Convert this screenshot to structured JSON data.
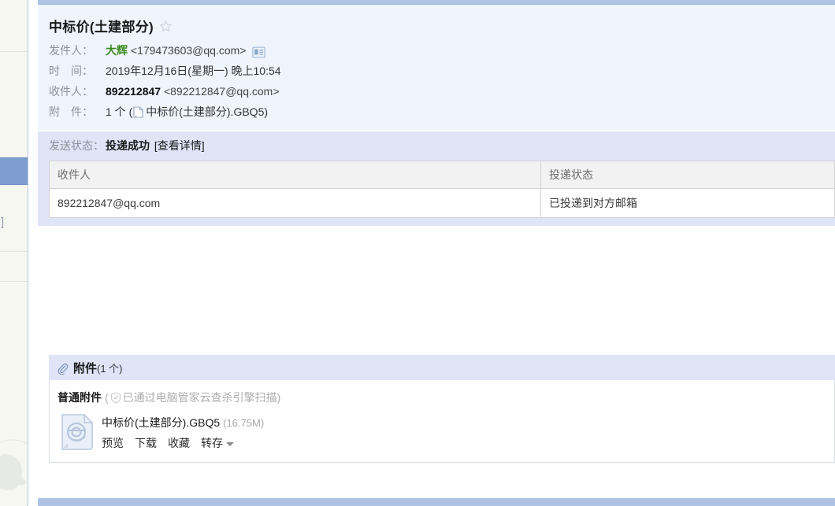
{
  "left_pane": {
    "truncated_text_fragment": "空]",
    "selected_row": true,
    "watermark": "qq-penguin-watermark"
  },
  "mail": {
    "subject": "中标价(土建部分)",
    "star_icon": "star-outline-icon",
    "from": {
      "label": "发件人：",
      "display_name": "大辉",
      "address": "<179473603@qq.com>",
      "contact_card_icon": "contact-card-icon"
    },
    "time": {
      "label": "时　间：",
      "value": "2019年12月16日(星期一) 晚上10:54"
    },
    "to": {
      "label": "收件人：",
      "display_name": "892212847",
      "address": "<892212847@qq.com>"
    },
    "attachment_summary": {
      "label": "附　件：",
      "count_text": "1 个 (",
      "file_icon": "file-icon",
      "file_name": "中标价(土建部分).GBQ5",
      "suffix": ")"
    }
  },
  "send_status": {
    "label": "发送状态：",
    "value": "投递成功",
    "detail_link": "[查看详情]",
    "table": {
      "columns": [
        "收件人",
        "投递状态"
      ],
      "rows": [
        [
          "892212847@qq.com",
          "已投递到对方邮箱"
        ]
      ]
    }
  },
  "attachments": {
    "header_icon": "paperclip-icon",
    "header_title": "附件",
    "header_count": "(1 个)",
    "kind_label": "普通附件",
    "scan_prefix": "(",
    "scan_icon": "shield-check-icon",
    "scan_text": "已通过电脑管家云查杀引擎扫描",
    "scan_suffix": ")",
    "items": [
      {
        "icon": "gbq-file-icon",
        "name": "中标价(土建部分).GBQ5",
        "size": "(16.75M)",
        "actions": [
          "预览",
          "下载",
          "收藏",
          "转存"
        ],
        "dropdown_icon": "caret-down-icon"
      }
    ]
  },
  "colors": {
    "accent_bar": "#aec3e4",
    "header_bg": "#eff4fd",
    "status_bg": "#dfe5f7",
    "selected_row": "#7d9dd0",
    "sender_name": "#3a8a1e"
  }
}
